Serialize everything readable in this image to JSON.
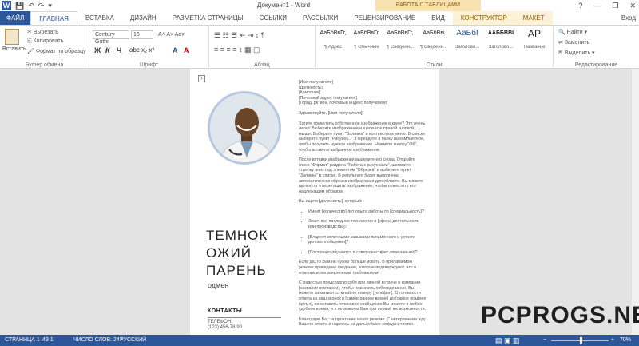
{
  "window": {
    "title": "Документ1 - Word",
    "context_title": "РАБОТА С ТАБЛИЦАМИ",
    "min": "—",
    "restore": "❐",
    "close": "✕",
    "help": "?"
  },
  "qat": {
    "save": "💾",
    "undo": "↶",
    "redo": "↷",
    "custom": "▾"
  },
  "tabs": [
    "ФАЙЛ",
    "ГЛАВНАЯ",
    "ВСТАВКА",
    "ДИЗАЙН",
    "РАЗМЕТКА СТРАНИЦЫ",
    "ССЫЛКИ",
    "РАССЫЛКИ",
    "РЕЦЕНЗИРОВАНИЕ",
    "ВИД",
    "КОНСТРУКТОР",
    "МАКЕТ"
  ],
  "login": "Вход",
  "clipboard": {
    "paste": "Вставить",
    "cut": "Вырезать",
    "copy": "Копировать",
    "painter": "Формат по образцу",
    "label": "Буфер обмена"
  },
  "font": {
    "name": "Century Gothi",
    "size": "16",
    "label": "Шрифт",
    "bold": "Ж",
    "italic": "К",
    "underline": "Ч"
  },
  "paragraph": {
    "label": "Абзац"
  },
  "styles": {
    "label": "Стили",
    "items": [
      {
        "preview": "АаБбВвГг,",
        "name": "¶ Адрес"
      },
      {
        "preview": "АаБбВвГг,",
        "name": "¶ Обычный"
      },
      {
        "preview": "АаБбВвГг,",
        "name": "¶ Сведени..."
      },
      {
        "preview": "АаБбВві",
        "name": "¶ Сведени..."
      },
      {
        "preview": "АаБбІ",
        "name": "Заголово..."
      },
      {
        "preview": "ААББВВІ",
        "name": "Заголово..."
      },
      {
        "preview": "АР",
        "name": "Название"
      }
    ]
  },
  "editing": {
    "find": "Найти",
    "replace": "Заменить",
    "select": "Выделить",
    "label": "Редактирование"
  },
  "resume": {
    "name_lines": [
      "ТЕМНОК",
      "ОЖИЙ",
      "ПАРЕНЬ"
    ],
    "profession": "одмен",
    "contacts_title": "КОНТАКТЫ",
    "phone_label": "ТЕЛЕФОН:",
    "phone": "(123) 456-78-90",
    "address": [
      "[Имя получателя]",
      "[Должность]",
      "[Компания]",
      "[Почтовый адрес получателя]",
      "[Город, регион, почтовый индекс получателя]"
    ],
    "greeting": "Здравствуйте, [Имя получателя]!",
    "p1": "Хотите поместить собственное изображение в круге? Это очень легко! Выберите изображение и щелкните правой кнопкой мыши. Выберите пункт \"Заливка\" в контекстном меню. В списке выберите пункт \"Рисунок...\". Перейдите в папку на компьютере, чтобы получить нужное изображение. Нажмите кнопку \"ОК\", чтобы вставить выбранное изображение.",
    "p2": "После вставки изображения выделите его снова. Откройте меню \"Формат\" раздела \"Работа с рисунками\", щелкните стрелку вниз под элементом \"Обрезка\" и выберите пункт \"Заливка\" в списке. В результате будет выполнена автоматическая обрезка изображения для области. Вы можете щелкнуть и перетащить изображение, чтобы поместить его надлежащим образом.",
    "p3": "Вы ищете [должность], который:",
    "bullets": [
      "Имеет [количество] лет опыта работы по [специальность]?",
      "Знает все последние технологии в [сфера деятельности или производства]?",
      "[Владеет отличными навыками письменного и устного делового общения]?",
      "[Постоянно обучается и совершенствует свои навыки]?"
    ],
    "p4": "Если да, то Вам не нужно больше искать. В прилагаемом резюме приведены сведения, которые подтверждают, что я отвечаю всем заявленным требованиям.",
    "p5": "С радостью представлю себя при личной встрече в компании [название компании], чтобы назначить собеседование, Вы можете связаться со мной по номеру [телефон]. О готовности ответа на ваш звонок в [самое раннее время] до [самое позднее время], но оставить голосовое сообщение Вы можете в любое удобное время, и я перезвоню Вам при первой же возможности.",
    "p6": "Благодарю Вас за прочтение моего резюме. С нетерпением жду Вашего ответа и надеюсь на дальнейшее сотрудничество."
  },
  "status": {
    "page": "СТРАНИЦА 1 ИЗ 1",
    "words": "ЧИСЛО СЛОВ: 247",
    "lang": "РУССКИЙ",
    "zoom": "70%"
  },
  "watermark": "PCPROGS.NET"
}
